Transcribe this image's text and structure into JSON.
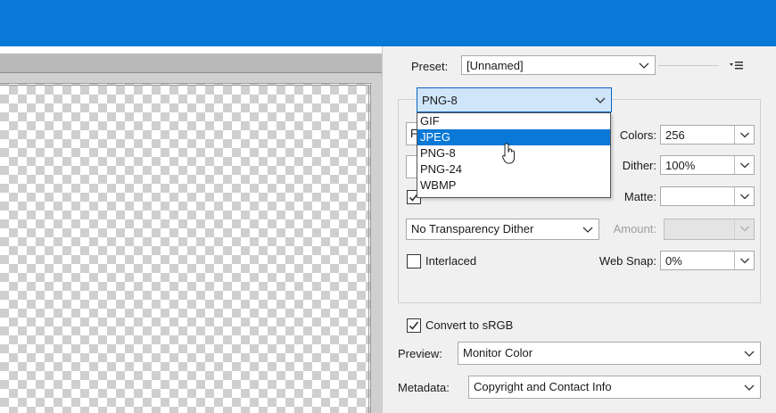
{
  "preset": {
    "label": "Preset:",
    "value": "[Unnamed]"
  },
  "format": {
    "value": "PNG-8",
    "options": [
      "GIF",
      "JPEG",
      "PNG-8",
      "PNG-24",
      "WBMP"
    ],
    "highlighted": "JPEG"
  },
  "colors": {
    "label": "Colors:",
    "value": "256"
  },
  "dither": {
    "label": "Dither:",
    "value": "100%"
  },
  "matte": {
    "label": "Matte:",
    "value": ""
  },
  "transparency": {
    "checked": true
  },
  "transparency_dither": {
    "value": "No Transparency Dither"
  },
  "amount": {
    "label": "Amount:",
    "value": ""
  },
  "interlaced": {
    "label": "Interlaced",
    "checked": false
  },
  "web_snap": {
    "label": "Web Snap:",
    "value": "0%"
  },
  "convert_srgb": {
    "label": "Convert to sRGB",
    "checked": true
  },
  "preview": {
    "label": "Preview:",
    "value": "Monitor Color"
  },
  "metadata": {
    "label": "Metadata:",
    "value": "Copyright and Contact Info"
  },
  "colors_theme": {
    "titlebar": "#0a78d7",
    "selection": "#0a78d7",
    "focus_border": "#0a66c2"
  },
  "icons": {
    "panel_menu": "panel-menu-icon",
    "cursor": "pointer-cursor-icon"
  }
}
